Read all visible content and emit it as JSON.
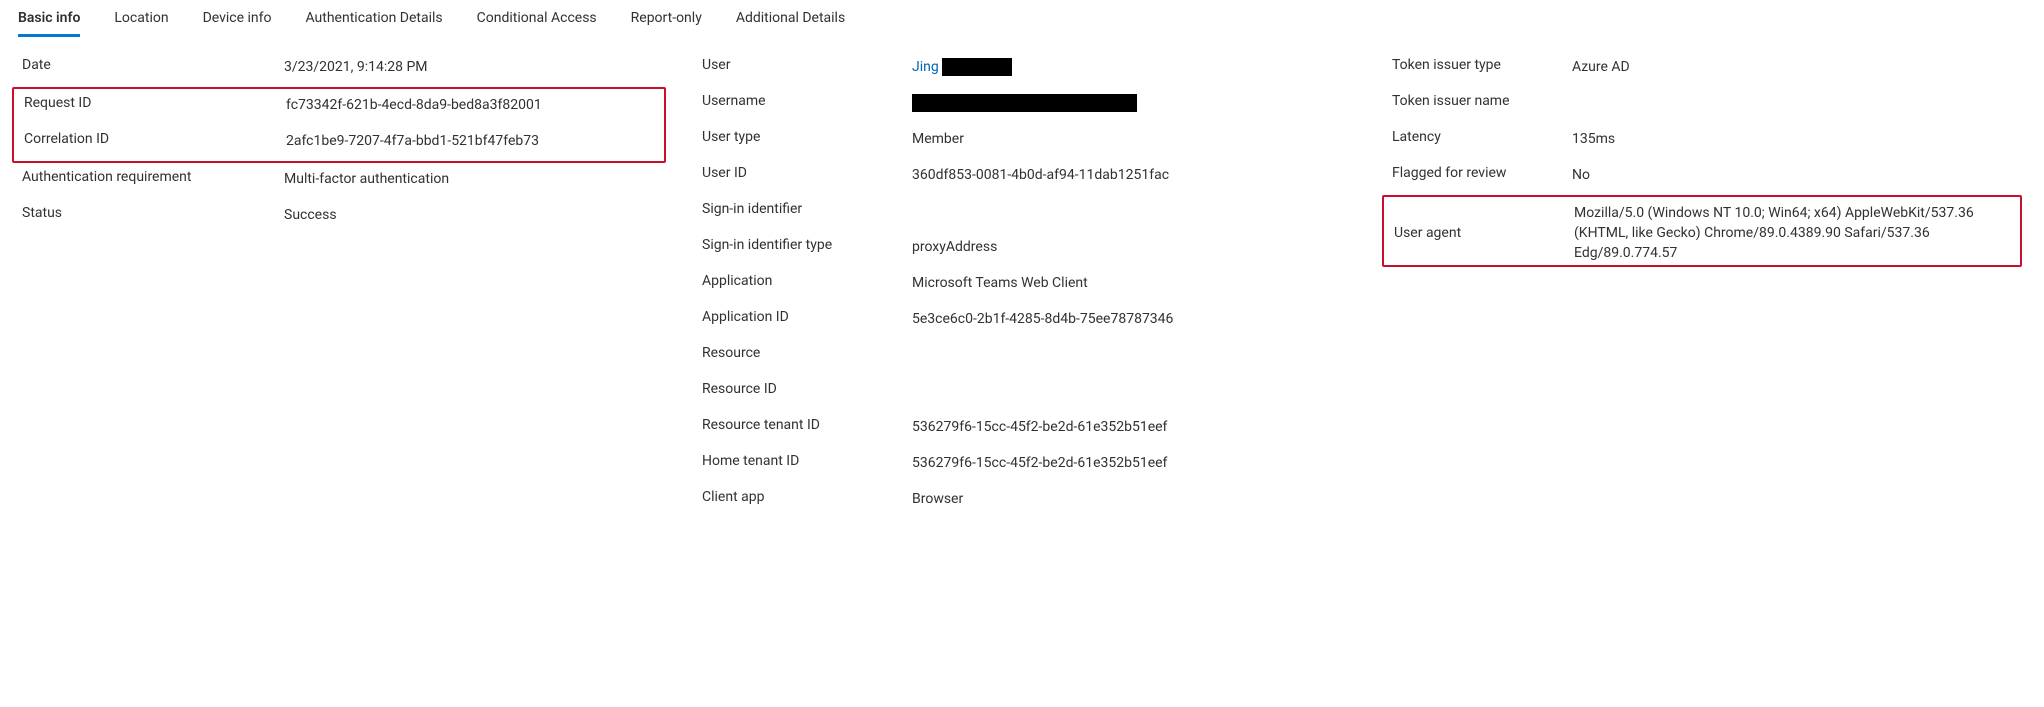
{
  "tabs": {
    "basic_info": "Basic info",
    "location": "Location",
    "device_info": "Device info",
    "auth_details": "Authentication Details",
    "conditional_access": "Conditional Access",
    "report_only": "Report-only",
    "additional_details": "Additional Details"
  },
  "col1": {
    "date_label": "Date",
    "date_value": "3/23/2021, 9:14:28 PM",
    "request_id_label": "Request ID",
    "request_id_value": "fc73342f-621b-4ecd-8da9-bed8a3f82001",
    "correlation_id_label": "Correlation ID",
    "correlation_id_value": "2afc1be9-7207-4f7a-bbd1-521bf47feb73",
    "auth_req_label": "Authentication requirement",
    "auth_req_value": "Multi-factor authentication",
    "status_label": "Status",
    "status_value": "Success"
  },
  "col2": {
    "user_label": "User",
    "user_value_visible": "Jing",
    "username_label": "Username",
    "user_type_label": "User type",
    "user_type_value": "Member",
    "user_id_label": "User ID",
    "user_id_value": "360df853-0081-4b0d-af94-11dab1251fac",
    "signin_identifier_label": "Sign-in identifier",
    "signin_identifier_type_label": "Sign-in identifier type",
    "signin_identifier_type_value": "proxyAddress",
    "application_label": "Application",
    "application_value": "Microsoft Teams Web Client",
    "application_id_label": "Application ID",
    "application_id_value": "5e3ce6c0-2b1f-4285-8d4b-75ee78787346",
    "resource_label": "Resource",
    "resource_id_label": "Resource ID",
    "resource_tenant_id_label": "Resource tenant ID",
    "resource_tenant_id_value": "536279f6-15cc-45f2-be2d-61e352b51eef",
    "home_tenant_id_label": "Home tenant ID",
    "home_tenant_id_value": "536279f6-15cc-45f2-be2d-61e352b51eef",
    "client_app_label": "Client app",
    "client_app_value": "Browser"
  },
  "col3": {
    "token_issuer_type_label": "Token issuer type",
    "token_issuer_type_value": "Azure AD",
    "token_issuer_name_label": "Token issuer name",
    "latency_label": "Latency",
    "latency_value": "135ms",
    "flagged_label": "Flagged for review",
    "flagged_value": "No",
    "user_agent_label": "User agent",
    "user_agent_value": "Mozilla/5.0 (Windows NT 10.0; Win64; x64) AppleWebKit/537.36 (KHTML, like Gecko) Chrome/89.0.4389.90 Safari/537.36 Edg/89.0.774.57"
  }
}
